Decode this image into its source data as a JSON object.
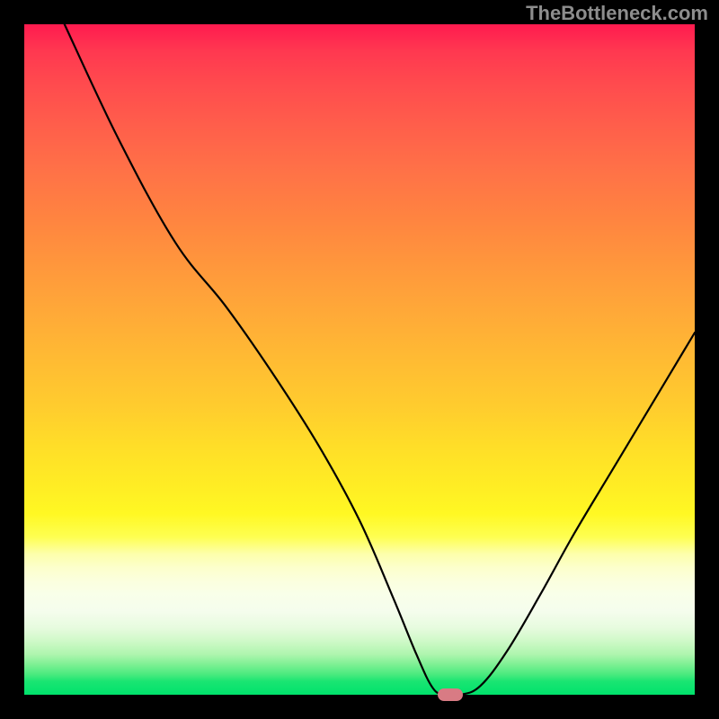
{
  "watermark": "TheBottleneck.com",
  "chart_data": {
    "type": "line",
    "title": "",
    "xlabel": "",
    "ylabel": "",
    "xlim": [
      0,
      100
    ],
    "ylim": [
      0,
      100
    ],
    "x": [
      6,
      14,
      22.5,
      30,
      37,
      44,
      50,
      55,
      58.5,
      60.8,
      62.5,
      65,
      68,
      72,
      77,
      82,
      88,
      94,
      100
    ],
    "values": [
      100,
      83,
      67.5,
      58,
      48,
      37,
      26,
      14.5,
      6,
      1.2,
      0,
      0,
      1.3,
      6.5,
      15,
      24,
      34,
      44,
      54
    ],
    "marker": {
      "x": 63.6,
      "y": 0
    }
  }
}
